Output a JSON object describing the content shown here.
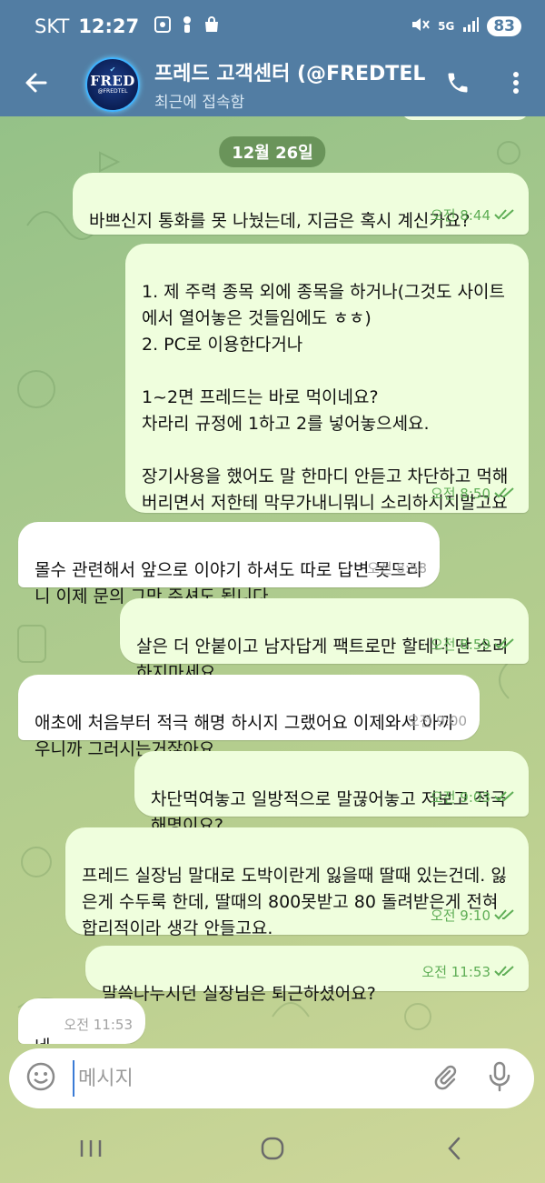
{
  "status_bar": {
    "carrier": "SKT",
    "time": "12:27",
    "battery": "83",
    "network": "5G"
  },
  "header": {
    "title": "프레드 고객센터 (@FREDTEL",
    "subtitle": "최근에 접속함",
    "avatar_text": "FRED",
    "avatar_subtext": "@FREDTEL",
    "back_icon": "arrow-left-icon",
    "call_icon": "phone-icon",
    "menu_icon": "more-vertical-icon"
  },
  "date_separator": "12월 26일",
  "messages": [
    {
      "dir": "out",
      "text": "바쁘신지 통화를 못 나눴는데, 지금은 혹시 계신가요?",
      "time": "오전 8:44"
    },
    {
      "dir": "out",
      "text": "1. 제 주력 종목 외에 종목을 하거나(그것도 사이트에서 열어놓은 것들임에도 ㅎㅎ)\n2. PC로 이용한다거나\n\n1~2면 프레드는 바로 먹이네요?\n차라리 규정에 1하고 2를 넣어놓으세요.\n\n장기사용을 했어도 말 한마디 안듣고 차단하고 먹해버리면서 저한테 막무가내니뭐니 소리하시지말고요",
      "time": "오전 8:50"
    },
    {
      "dir": "in",
      "text": "몰수 관련해서 앞으로 이야기 하셔도 따로 답변 못드리니 이제 문의 그만 주셔도 됩니다.",
      "time": "오전 8:58"
    },
    {
      "dir": "out",
      "text": "살은 더 안붙이고 남자답게 팩트로만 할테니 딴 소리하지마세요",
      "time": "오전 8:59"
    },
    {
      "dir": "in",
      "text": "애초에 처음부터 적극 해명 하시지 그랬어요 이제와서 아까우니까 그러시는거잖아요",
      "time": "오전 9:00"
    },
    {
      "dir": "out",
      "text": "차단먹여놓고 일방적으로 말끊어놓고 저보고 적극해명이요?",
      "time": "오전 9:03"
    },
    {
      "dir": "out",
      "text": "프레드 실장님 말대로 도박이란게 잃을때 딸때 있는건데. 잃은게 수두룩 한데, 딸때의 800못받고 80 돌려받은게 전혀 합리적이라 생각 안들고요.",
      "time": "오전 9:10"
    },
    {
      "dir": "out",
      "text": "말씀나누시던 실장님은 퇴근하셨어요?",
      "time": "오전 11:53"
    },
    {
      "dir": "in",
      "text": "네",
      "time": "오전 11:53"
    }
  ],
  "composer": {
    "placeholder": "메시지",
    "emoji_icon": "smiley-icon",
    "attach_icon": "paperclip-icon",
    "mic_icon": "microphone-icon"
  },
  "navbar": {
    "recents_icon": "recents-icon",
    "home_icon": "home-icon",
    "back_icon": "nav-back-icon"
  },
  "colors": {
    "header": "#527da3",
    "outgoing_bubble": "#effedd",
    "incoming_bubble": "#ffffff",
    "tick": "#5fae56"
  }
}
